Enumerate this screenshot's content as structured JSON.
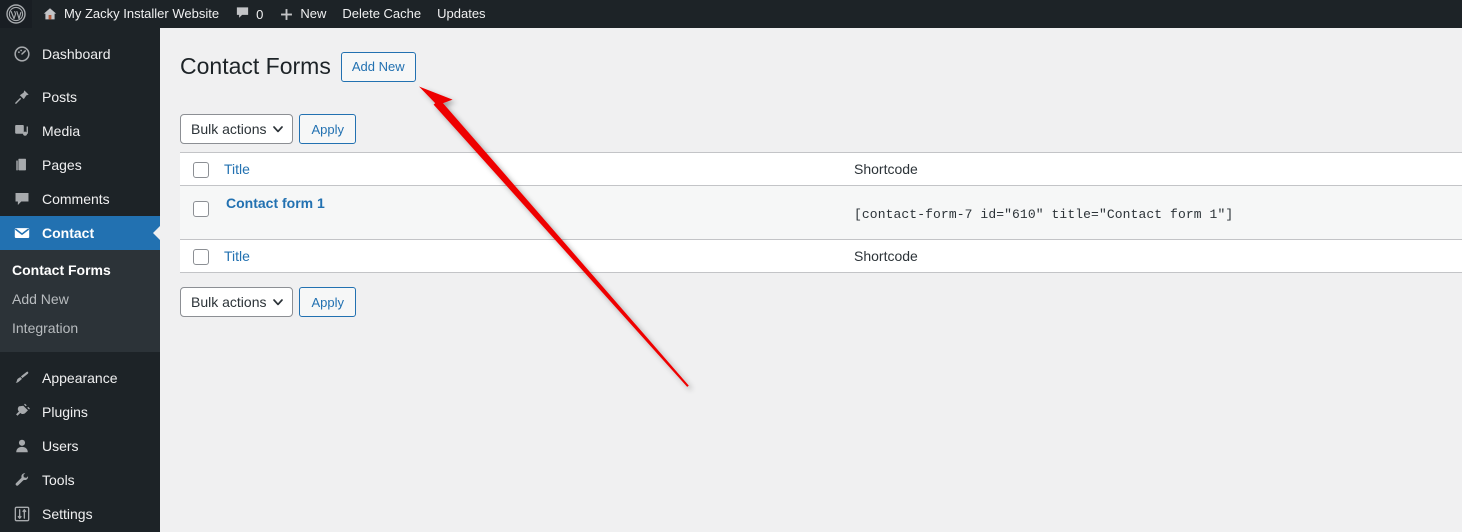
{
  "adminbar": {
    "wp_logo_icon": "wordpress-logo-icon",
    "site_home_icon": "home-icon",
    "site_name": "My Zacky Installer Website",
    "comments_icon": "comment-bubble-icon",
    "comments_count": "0",
    "new_icon": "plus-icon",
    "new_label": "New",
    "delete_cache_label": "Delete Cache",
    "updates_label": "Updates"
  },
  "sidebar": {
    "items": [
      {
        "label": "Dashboard",
        "icon": "dashboard-gauge-icon",
        "current": false
      },
      {
        "label": "Posts",
        "icon": "pin-icon",
        "current": false
      },
      {
        "label": "Media",
        "icon": "media-icon",
        "current": false
      },
      {
        "label": "Pages",
        "icon": "pages-icon",
        "current": false
      },
      {
        "label": "Comments",
        "icon": "comment-bubble-icon",
        "current": false
      },
      {
        "label": "Contact",
        "icon": "envelope-icon",
        "current": true
      },
      {
        "label": "Appearance",
        "icon": "paintbrush-icon",
        "current": false
      },
      {
        "label": "Plugins",
        "icon": "plug-icon",
        "current": false
      },
      {
        "label": "Users",
        "icon": "user-icon",
        "current": false
      },
      {
        "label": "Tools",
        "icon": "wrench-icon",
        "current": false
      },
      {
        "label": "Settings",
        "icon": "sliders-icon",
        "current": false
      }
    ],
    "submenu": [
      {
        "label": "Contact Forms",
        "current": true
      },
      {
        "label": "Add New",
        "current": false
      },
      {
        "label": "Integration",
        "current": false
      }
    ]
  },
  "page": {
    "title": "Contact Forms",
    "add_new_label": "Add New"
  },
  "tablenav_top": {
    "bulk_actions_label": "Bulk actions",
    "chevron_icon": "chevron-down-icon",
    "apply_label": "Apply"
  },
  "tablenav_bottom": {
    "bulk_actions_label": "Bulk actions",
    "chevron_icon": "chevron-down-icon",
    "apply_label": "Apply"
  },
  "table": {
    "columns": {
      "select_all_name": "select-all-checkbox",
      "title": "Title",
      "shortcode": "Shortcode"
    },
    "rows": [
      {
        "title": "Contact form 1",
        "shortcode": "[contact-form-7 id=\"610\" title=\"Contact form 1\"]"
      }
    ]
  },
  "annotation": {
    "arrow_color": "#ee0000",
    "arrow_name": "red-arrow-annotation",
    "points_to": "Add New"
  },
  "colors": {
    "admin_bar_bg": "#1d2327",
    "sidebar_bg": "#1d2327",
    "submenu_bg": "#2c3338",
    "current_menu_bg": "#2271b1",
    "link_blue": "#2271b1",
    "content_bg": "#f0f0f1",
    "row_alt_bg": "#f6f7f7",
    "border_gray": "#c3c4c7"
  }
}
